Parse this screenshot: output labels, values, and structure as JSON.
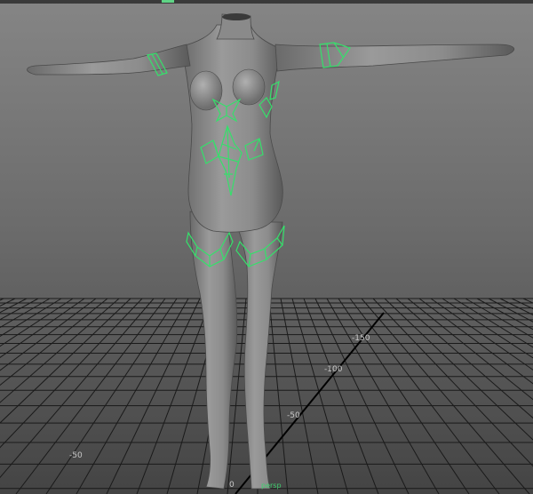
{
  "viewport": {
    "name": "3D perspective viewport",
    "camera_label": "persp"
  },
  "grid": {
    "axis_labels": [
      "-50",
      "0",
      "-50",
      "-100",
      "-150"
    ]
  },
  "colors": {
    "background_top": "#858585",
    "background_bottom": "#444444",
    "grid_line": "#1a1a1a",
    "grid_label": "#c8c8c8",
    "mesh_body": "#8a8a8a",
    "selection_wire": "#35e06b",
    "camera_label": "#40d070"
  },
  "model": {
    "type": "female body base mesh (T-pose)",
    "selected_components": "green wireframe armor pieces"
  }
}
